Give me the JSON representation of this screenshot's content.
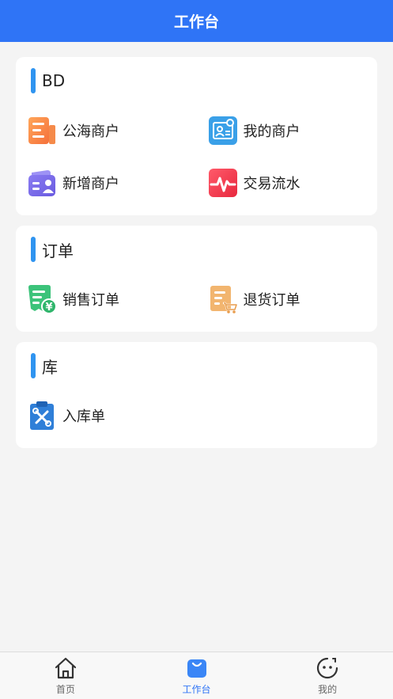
{
  "header": {
    "title": "工作台"
  },
  "sections": [
    {
      "title": "BD",
      "items": [
        {
          "label": "公海商户",
          "icon": "public-merchants-icon"
        },
        {
          "label": "我的商户",
          "icon": "my-merchants-icon"
        },
        {
          "label": "新增商户",
          "icon": "add-merchant-icon"
        },
        {
          "label": "交易流水",
          "icon": "transactions-icon"
        }
      ]
    },
    {
      "title": "订单",
      "items": [
        {
          "label": "销售订单",
          "icon": "sales-order-icon"
        },
        {
          "label": "退货订单",
          "icon": "return-order-icon"
        }
      ]
    },
    {
      "title": "库",
      "items": [
        {
          "label": "入库单",
          "icon": "stock-in-icon"
        }
      ]
    }
  ],
  "tabbar": {
    "tabs": [
      {
        "label": "首页",
        "icon": "home-icon"
      },
      {
        "label": "工作台",
        "icon": "workbench-icon",
        "active": true
      },
      {
        "label": "我的",
        "icon": "profile-icon"
      }
    ]
  },
  "colors": {
    "primary": "#2f74f6",
    "accent_bar": "#2f94f0",
    "background": "#f4f4f4"
  }
}
